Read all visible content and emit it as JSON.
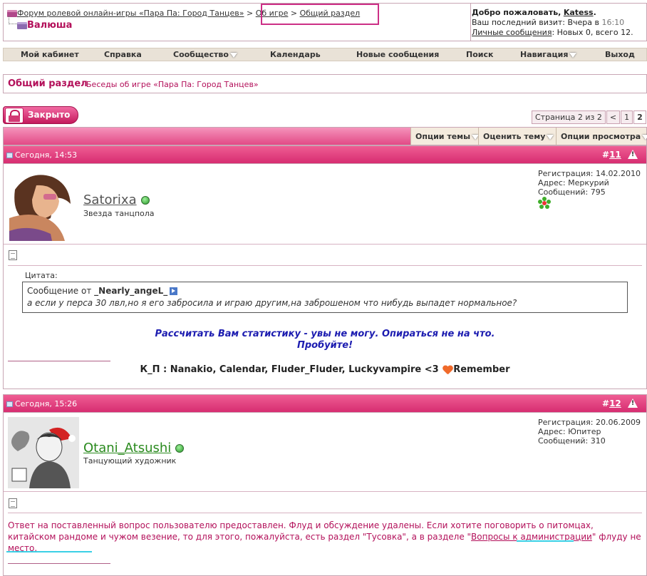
{
  "breadcrumb": {
    "forum_name": "Форум ролевой онлайн-игры «Пара Па: Город Танцев»",
    "sep1": ">",
    "about_game": "Об игре",
    "sep2": ">",
    "general": "Общий раздел",
    "thread_title": "Валюша"
  },
  "welcome": {
    "greeting": "Добро пожаловать,",
    "username": "Katess",
    "last_visit_label": "Ваш последний визит: Вчера в",
    "last_visit_time": "16:10",
    "pm_link": "Личные сообщения",
    "pm_status": ": Новых 0, всего 12."
  },
  "nav": {
    "cabinet": "Мой кабинет",
    "help": "Справка",
    "community": "Сообщество",
    "calendar": "Календарь",
    "new_posts": "Новые сообщения",
    "search": "Поиск",
    "navigation": "Навигация",
    "logout": "Выход"
  },
  "forum": {
    "title": "Общий раздел",
    "subtitle": "Беседы об игре «Пара Па: Город Танцев»"
  },
  "closed_button": "Закрыто",
  "pager": {
    "label": "Страница 2 из 2",
    "prev": "<",
    "p1": "1",
    "p2": "2"
  },
  "options": {
    "thread_tools": "Опции темы",
    "rate": "Оценить тему",
    "display": "Опции просмотра"
  },
  "posts": [
    {
      "date": "Сегодня, 14:53",
      "hash": "#",
      "num": "11",
      "username": "Satorixa",
      "user_title": "Звезда танцпола",
      "reg": "Регистрация: 14.02.2010",
      "addr": "Адрес: Меркурий",
      "count": "Сообщений: 795",
      "quote_label": "Цитата:",
      "quote_from_prefix": "Сообщение от",
      "quote_author": "_Nearly_angeL_",
      "quote_text": "а если у перса 30 лвл,но я его забросила и играю другим,на заброшеном что нибудь выпадет нормальное?",
      "reply_line1": "Рассчитать Вам статистику - увы не могу. Опираться не на что.",
      "reply_line2": "Пробуйте!",
      "signature_a": "К_П : Nanakio, Calendar, Fluder_Fluder, Luckyvampire <3",
      "signature_b": "Remember"
    },
    {
      "date": "Сегодня, 15:26",
      "hash": "#",
      "num": "12",
      "username": "Otani_Atsushi",
      "user_title": "Танцующий художник",
      "reg": "Регистрация: 20.06.2009",
      "addr": "Адрес: Юпитер",
      "count": "Сообщений: 310",
      "body_a": "Ответ на поставленный вопрос пользователю предоставлен. Флуд и обсуждение удалены. Если хотите поговорить о питомцах, китайском рандоме и чужом везение, то для этого, пожалуйста, есть раздел \"Тусовка\", а в разделе \"",
      "body_link": "Вопросы к администрации",
      "body_b": "\" флуду не место."
    }
  ],
  "colors": {
    "accent": "#b3105a",
    "header_pink": "#e24a86",
    "highlight_box": "#cc2f86",
    "annotation_cyan": "#3ad0e6"
  }
}
